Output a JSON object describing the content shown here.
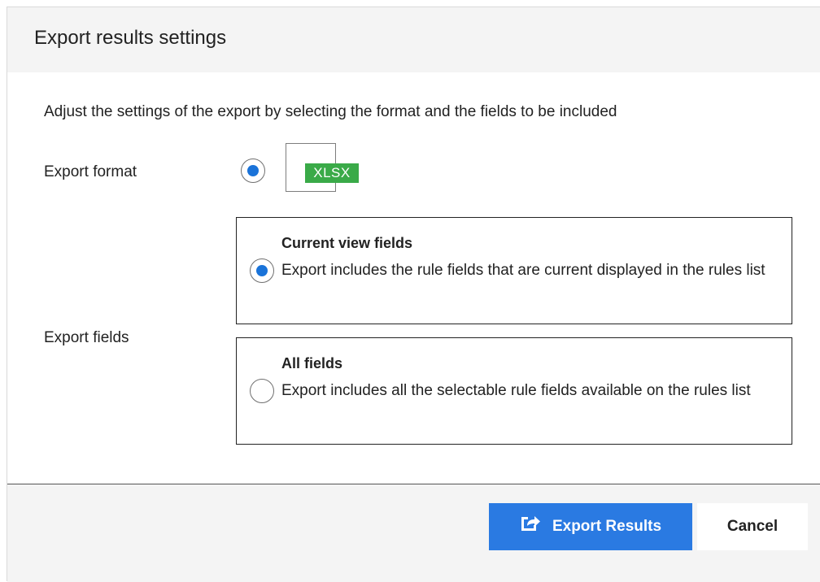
{
  "dialog": {
    "title": "Export results settings",
    "description": "Adjust the settings of the export by selecting the format and the fields to be included"
  },
  "export_format": {
    "label": "Export format",
    "options": [
      {
        "badge": "XLSX",
        "icon": "xlsx-file-icon",
        "selected": true
      }
    ]
  },
  "export_fields": {
    "label": "Export fields",
    "options": [
      {
        "title": "Current view fields",
        "description": "Export includes the rule fields that are current displayed in the rules list",
        "selected": true
      },
      {
        "title": "All fields",
        "description": "Export includes all the selectable rule fields available on the rules list",
        "selected": false
      }
    ]
  },
  "footer": {
    "export_label": "Export Results",
    "export_icon": "share-export-icon",
    "cancel_label": "Cancel"
  },
  "colors": {
    "accent": "#2a7ae2",
    "radio_selected": "#1a73d9",
    "xlsx_badge": "#3aaa48",
    "header_bg": "#f4f4f4"
  }
}
